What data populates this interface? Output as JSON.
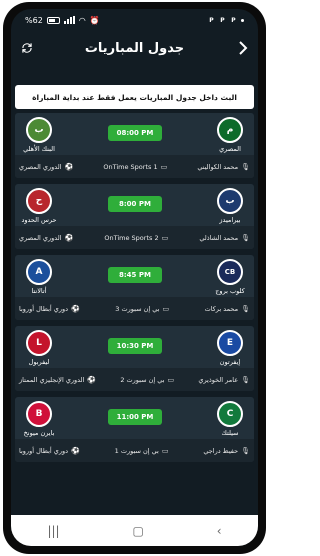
{
  "status": {
    "battery_pct": "%62",
    "icons_right": [
      "P",
      "P",
      "P"
    ]
  },
  "header": {
    "title": "جدول المباريات"
  },
  "notice": "البث داخل جدول المباريات يعمل فقط عند بداية المباراة",
  "matches": [
    {
      "time": "08:00 PM",
      "home": "المصري",
      "away": "البنك الأهلي",
      "home_color": "#0d6b2a",
      "away_color": "#4c8a34",
      "home_abbr": "م",
      "away_abbr": "ب",
      "commentator": "محمد الكواليني",
      "channel": "OnTime Sports 1",
      "league": "الدوري المصري"
    },
    {
      "time": "8:00 PM",
      "home": "بيراميدز",
      "away": "حرس الحدود",
      "home_color": "#1d3a6e",
      "away_color": "#b8262d",
      "home_abbr": "ب",
      "away_abbr": "ح",
      "commentator": "محمد الشاذلي",
      "channel": "OnTime Sports 2",
      "league": "الدوري المصري"
    },
    {
      "time": "8:45 PM",
      "home": "كلوب بروج",
      "away": "أتالانتا",
      "home_color": "#1a2a5a",
      "away_color": "#1b4f9c",
      "home_abbr": "CB",
      "away_abbr": "A",
      "commentator": "محمد بركات",
      "channel": "بي إن سبورت 3",
      "league": "دوري أبطال أوروبا"
    },
    {
      "time": "10:30 PM",
      "home": "إيفرتون",
      "away": "ليفربول",
      "home_color": "#1a4aa3",
      "away_color": "#c4142c",
      "home_abbr": "E",
      "away_abbr": "L",
      "commentator": "عامر الخوذيري",
      "channel": "بي إن سبورت 2",
      "league": "الدوري الإنجليزي الممتاز"
    },
    {
      "time": "11:00 PM",
      "home": "سيلتك",
      "away": "بايرن ميونخ",
      "home_color": "#127a3c",
      "away_color": "#d0103a",
      "home_abbr": "C",
      "away_abbr": "B",
      "commentator": "حفيظ دراجي",
      "channel": "بي إن سبورت 1",
      "league": "دوري أبطال أوروبا"
    }
  ]
}
